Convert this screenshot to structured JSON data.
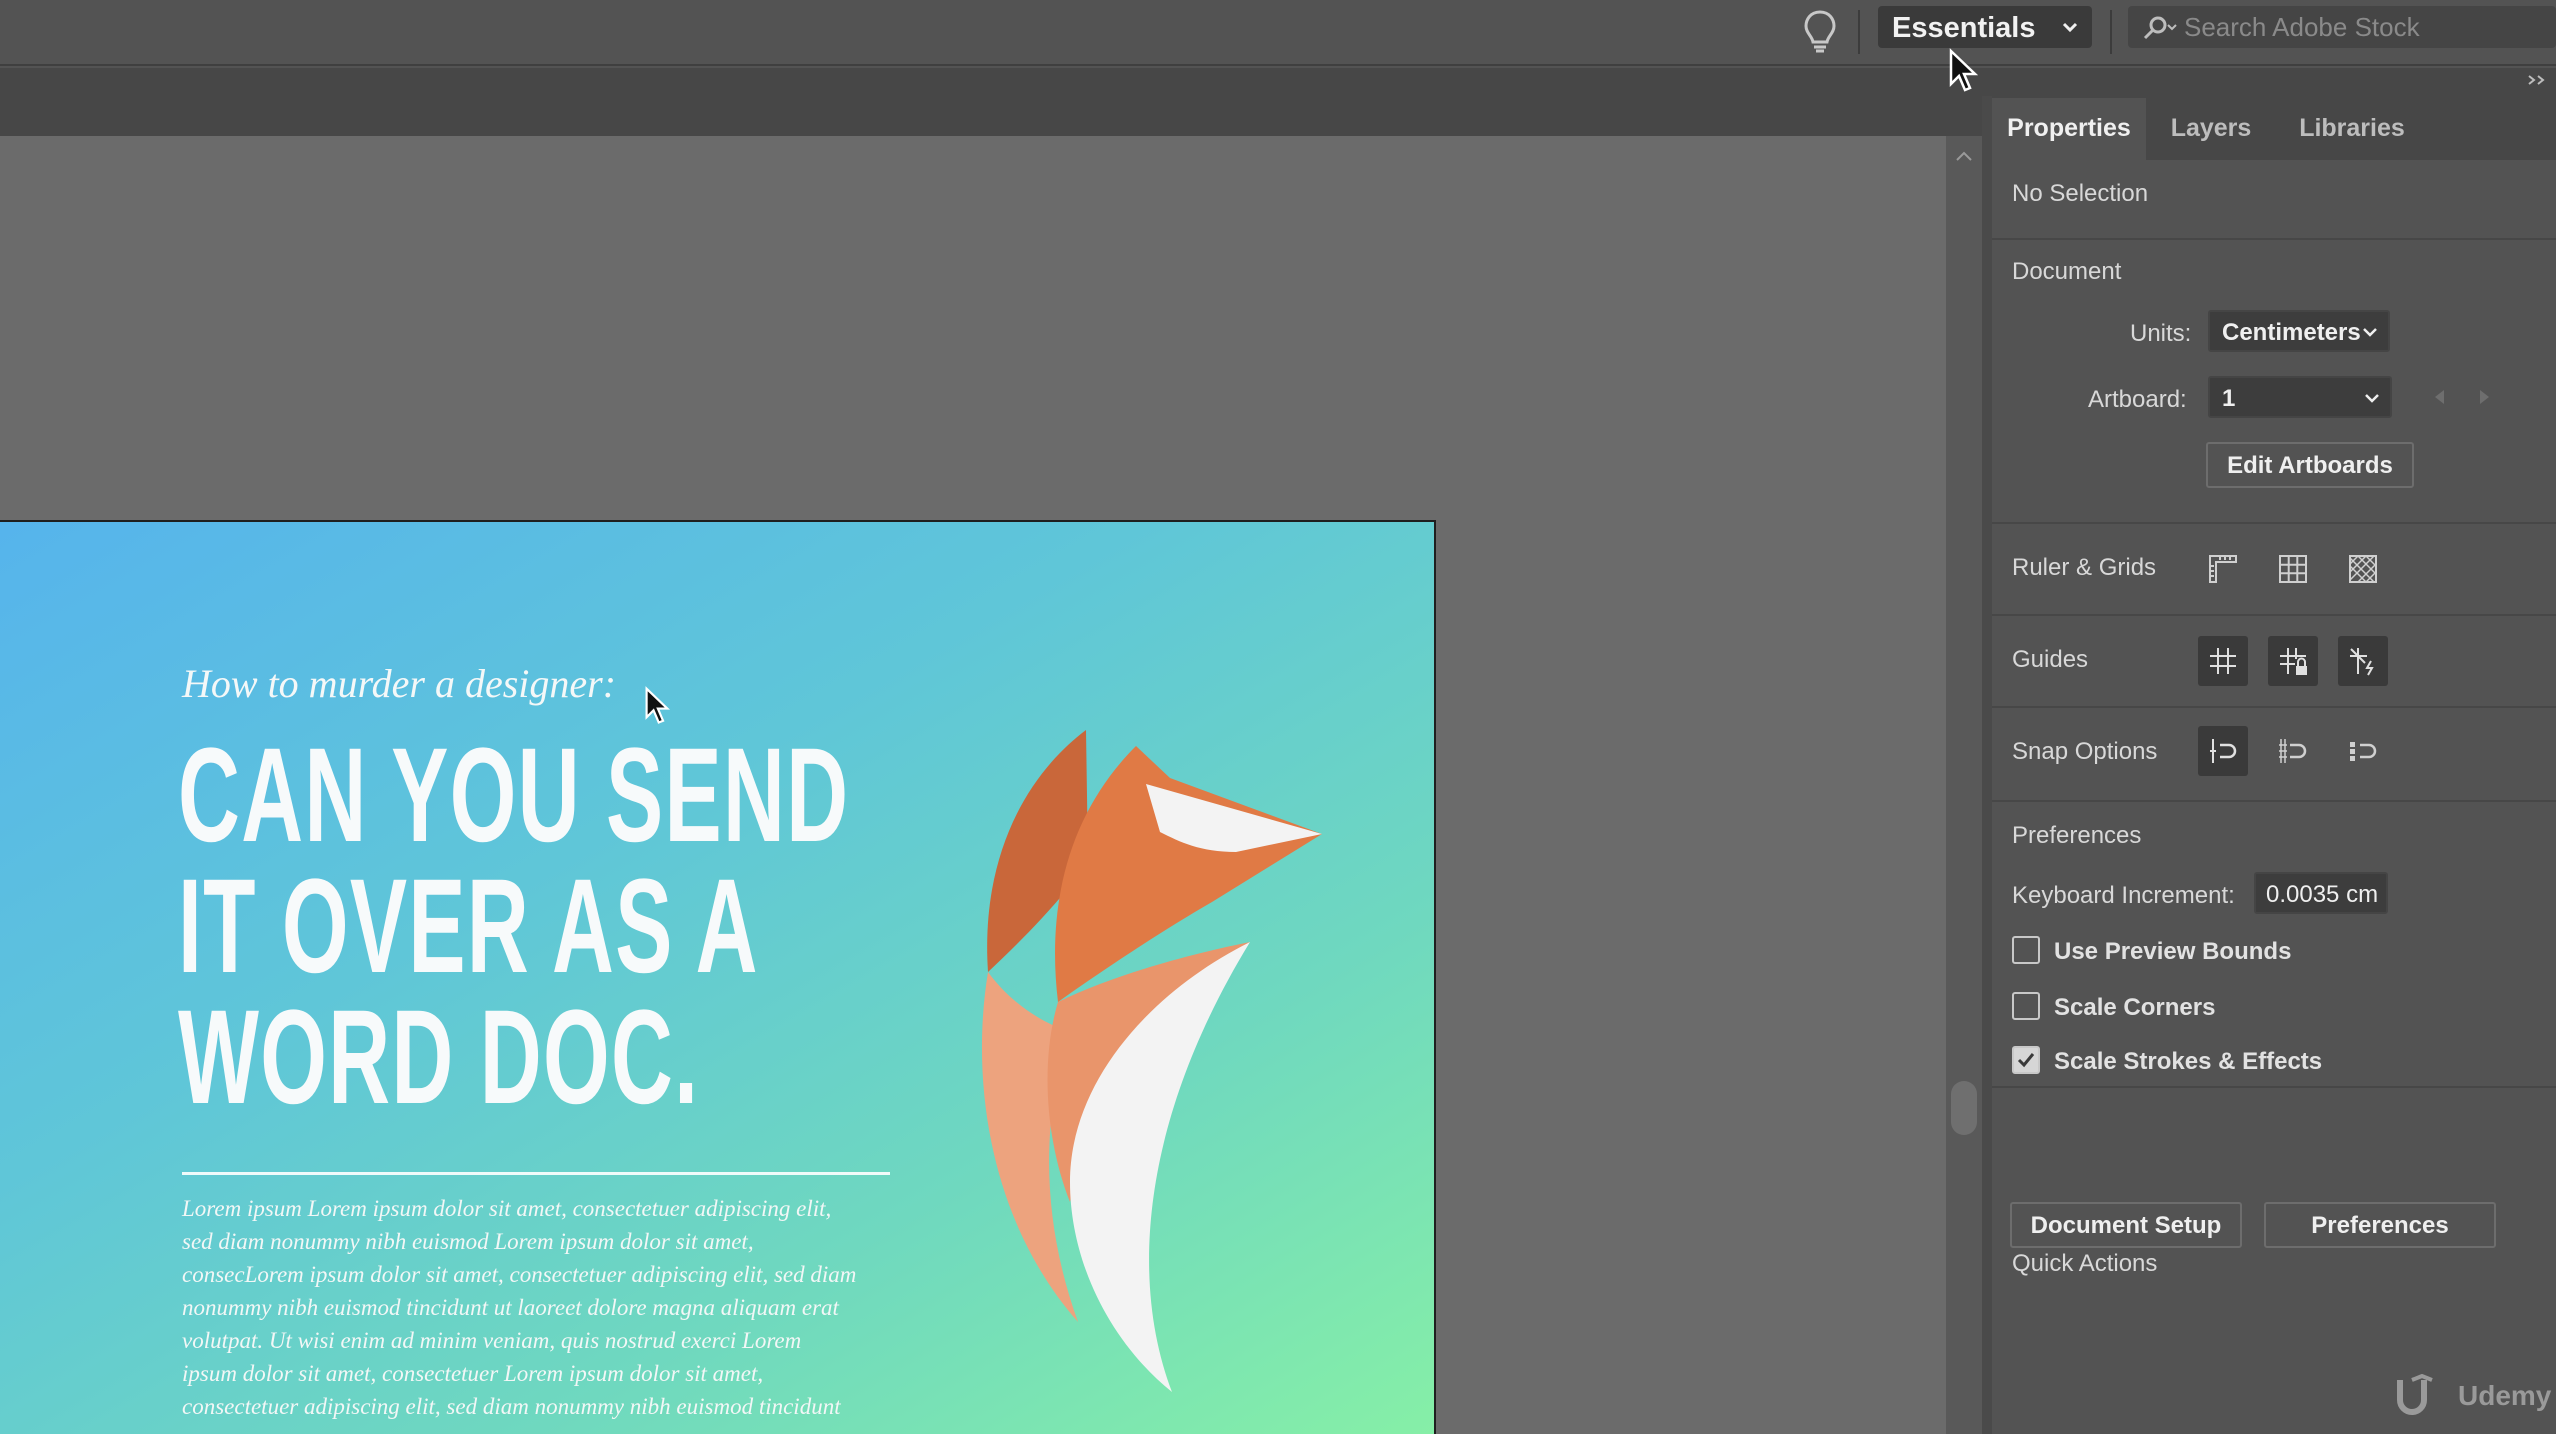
{
  "topbar": {
    "workspace": "Essentials",
    "search_placeholder": "Search Adobe Stock"
  },
  "artboard": {
    "kicker": "How to murder a designer:",
    "headline": [
      "CAN YOU SEND",
      "IT OVER AS A",
      "WORD DOC."
    ],
    "body": [
      "Lorem ipsum Lorem ipsum dolor sit amet, consectetuer adipiscing elit,",
      "sed diam nonummy nibh euismod Lorem ipsum dolor sit amet,",
      "consecLorem ipsum dolor sit amet, consectetuer adipiscing elit, sed diam",
      "nonummy nibh euismod tincidunt ut laoreet dolore magna aliquam erat",
      "volutpat. Ut wisi enim ad minim veniam, quis nostrud exerci Lorem",
      "ipsum dolor sit amet, consectetuer Lorem ipsum dolor sit amet,",
      "consectetuer adipiscing elit, sed diam nonummy nibh euismod tincidunt"
    ]
  },
  "panel": {
    "tabs": [
      "Properties",
      "Layers",
      "Libraries"
    ],
    "active_tab": "Properties",
    "selection": "No Selection",
    "document": {
      "title": "Document",
      "units_label": "Units:",
      "units_value": "Centimeters",
      "artboard_label": "Artboard:",
      "artboard_value": "1",
      "edit_artboards": "Edit Artboards"
    },
    "ruler_grids": "Ruler & Grids",
    "guides": "Guides",
    "snap_options": "Snap Options",
    "preferences": {
      "title": "Preferences",
      "keyboard_increment_label": "Keyboard Increment:",
      "keyboard_increment_value": "0.0035 cm",
      "use_preview_bounds": "Use Preview Bounds",
      "scale_corners": "Scale Corners",
      "scale_strokes_effects": "Scale Strokes & Effects",
      "checked": {
        "use_preview_bounds": false,
        "scale_corners": false,
        "scale_strokes_effects": true
      }
    },
    "quick_actions": {
      "title": "Quick Actions",
      "document_setup": "Document Setup",
      "preferences": "Preferences"
    }
  },
  "watermark": "Udemy",
  "icons": [
    "lightbulb-icon",
    "chevron-down-icon",
    "search-icon",
    "rulers-icon",
    "grid-icon",
    "transparency-grid-icon",
    "guides-icon",
    "lock-guides-icon",
    "smart-guides-icon",
    "snap-to-point-icon",
    "snap-to-grid-icon",
    "snap-to-pixel-icon",
    "fox-illustration"
  ],
  "colors": {
    "artboard_gradient": [
      "#56b4ec",
      "#86efa7"
    ],
    "fox_orange": "#e07a45",
    "fox_dark": "#c9673a",
    "fox_light": "#eda37e"
  }
}
